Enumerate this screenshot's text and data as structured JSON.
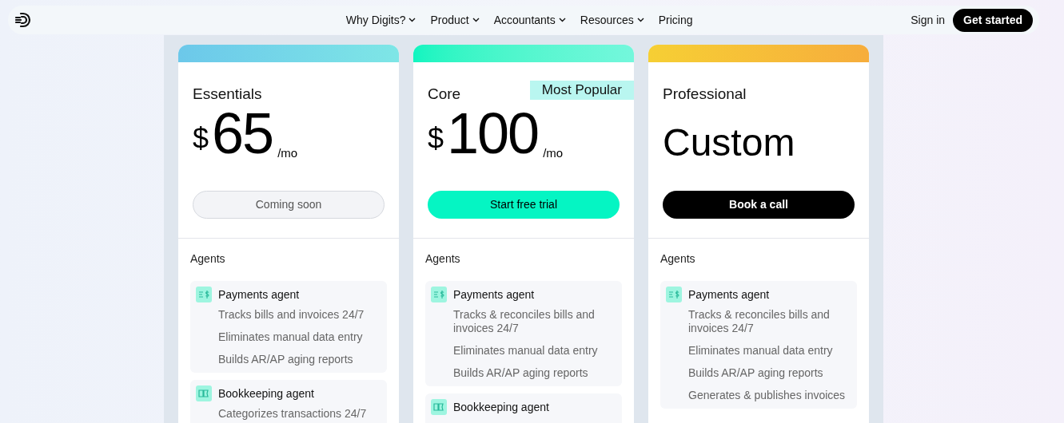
{
  "nav": {
    "links": [
      {
        "label": "Why Digits?",
        "dropdown": true
      },
      {
        "label": "Product",
        "dropdown": true
      },
      {
        "label": "Accountants",
        "dropdown": true
      },
      {
        "label": "Resources",
        "dropdown": true
      },
      {
        "label": "Pricing",
        "dropdown": false
      }
    ],
    "sign_in": "Sign in",
    "cta": "Get started"
  },
  "plans": [
    {
      "name": "Essentials",
      "price": {
        "kind": "amount",
        "currency": "$",
        "amount": "65",
        "period": "/mo"
      },
      "button": {
        "label": "Coming soon",
        "kind": "muted"
      },
      "section": "Agents",
      "agents": [
        {
          "name": "Payments agent",
          "features": [
            "Tracks bills and invoices 24/7",
            "Eliminates manual data entry",
            "Builds AR/AP aging reports"
          ]
        },
        {
          "name": "Bookkeeping agent",
          "features": [
            "Categorizes transactions 24/7"
          ]
        }
      ]
    },
    {
      "name": "Core",
      "badge": "Most Popular",
      "price": {
        "kind": "amount",
        "currency": "$",
        "amount": "100",
        "period": "/mo"
      },
      "button": {
        "label": "Start free trial",
        "kind": "mint"
      },
      "section": "Agents",
      "agents": [
        {
          "name": "Payments agent",
          "features": [
            "Tracks & reconciles bills and invoices 24/7",
            "Eliminates manual data entry",
            "Builds AR/AP aging reports"
          ]
        },
        {
          "name": "Bookkeeping agent"
        }
      ]
    },
    {
      "name": "Professional",
      "price": {
        "kind": "custom",
        "label": "Custom"
      },
      "button": {
        "label": "Book a call",
        "kind": "black"
      },
      "section": "Agents",
      "agents": [
        {
          "name": "Payments agent",
          "features": [
            "Tracks & reconciles bills and invoices 24/7",
            "Eliminates manual data entry",
            "Builds AR/AP aging reports",
            "Generates & publishes invoices"
          ]
        }
      ]
    }
  ]
}
